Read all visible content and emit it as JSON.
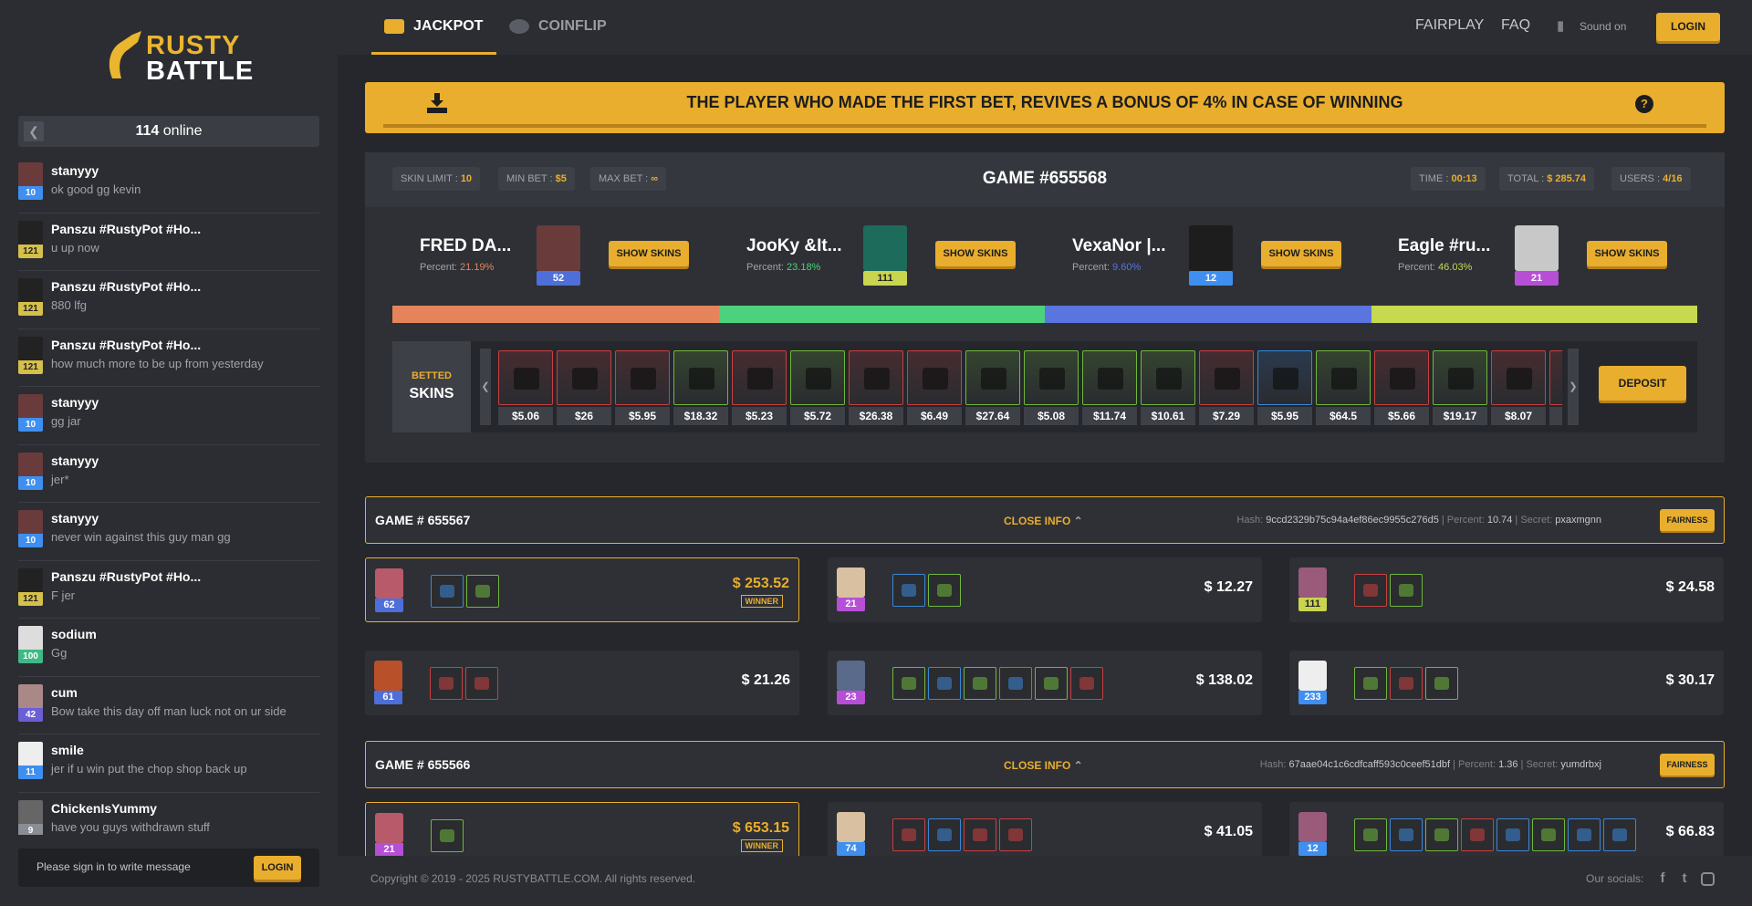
{
  "brand": {
    "line1": "RUSTY",
    "line2": "BATTLE"
  },
  "online": {
    "count": "114",
    "label": " online"
  },
  "chat": [
    {
      "name": "stanyyy",
      "text": "ok good gg kevin",
      "level": "10",
      "lvcolor": "#3f8ff0"
    },
    {
      "name": "Panszu #RustyPot #Ho...",
      "text": "u up now",
      "level": "121",
      "lvcolor": "#d4c04a"
    },
    {
      "name": "Panszu #RustyPot #Ho...",
      "text": "880 lfg",
      "level": "121",
      "lvcolor": "#d4c04a"
    },
    {
      "name": "Panszu #RustyPot #Ho...",
      "text": "how much more to be up from yesterday",
      "level": "121",
      "lvcolor": "#d4c04a"
    },
    {
      "name": "stanyyy",
      "text": "gg jar",
      "level": "10",
      "lvcolor": "#3f8ff0"
    },
    {
      "name": "stanyyy",
      "text": "jer*",
      "level": "10",
      "lvcolor": "#3f8ff0"
    },
    {
      "name": "stanyyy",
      "text": "never win against this guy man gg",
      "level": "10",
      "lvcolor": "#3f8ff0"
    },
    {
      "name": "Panszu #RustyPot #Ho...",
      "text": "F jer",
      "level": "121",
      "lvcolor": "#d4c04a"
    },
    {
      "name": "sodium",
      "text": "Gg",
      "level": "100",
      "lvcolor": "#3fb985"
    },
    {
      "name": "cum",
      "text": "Bow take this day off man luck not on ur side",
      "level": "42",
      "lvcolor": "#6a5fd6"
    },
    {
      "name": "smile",
      "text": "jer if u win put the chop shop back up",
      "level": "11",
      "lvcolor": "#3f8ff0"
    },
    {
      "name": "ChickenIsYummy",
      "text": "have you guys withdrawn stuff",
      "level": "9",
      "lvcolor": "#8a8d95"
    }
  ],
  "chat_input": {
    "placeholder": "Please sign in to write message",
    "login": "LOGIN"
  },
  "nav": {
    "jackpot": "JACKPOT",
    "coinflip": "COINFLIP",
    "fairplay": "FAIRPLAY",
    "faq": "FAQ",
    "sound": "Sound on",
    "login": "LOGIN"
  },
  "banner": {
    "text": "THE PLAYER WHO MADE THE FIRST BET, REVIVES A BONUS OF 4% IN CASE OF WINNING",
    "help": "?"
  },
  "game": {
    "title": "GAME #655568",
    "skin_limit_label": "SKIN LIMIT : ",
    "skin_limit": "10",
    "min_bet_label": "MIN BET : ",
    "min_bet": "$5",
    "max_bet_label": "MAX BET : ",
    "max_bet": "∞",
    "time_label": "TIME : ",
    "time": "00:13",
    "total_label": "TOTAL : ",
    "total": "$ 285.74",
    "users_label": "USERS : ",
    "users": "4/16",
    "show_skins": "SHOW SKINS",
    "percent_label": "Percent: ",
    "players": [
      {
        "name": "FRED DA...",
        "percent": "21.19%",
        "color": "#e5845a",
        "level": "52",
        "lvcolor": "#4e6fd9"
      },
      {
        "name": "JooKy &It...",
        "percent": "23.18%",
        "color": "#4cd27c",
        "level": "111",
        "lvcolor": "#c9d54e"
      },
      {
        "name": "VexaNor |...",
        "percent": "9.60%",
        "color": "#5a74e0",
        "level": "12",
        "lvcolor": "#3f8ff0"
      },
      {
        "name": "Eagle #ru...",
        "percent": "46.03%",
        "color": "#c6d94f",
        "level": "21",
        "lvcolor": "#b64fd6"
      }
    ],
    "betted_a": "BETTED",
    "betted_b": "SKINS",
    "deposit": "DEPOSIT",
    "skins": [
      {
        "price": "$5.06",
        "c": "#c84040"
      },
      {
        "price": "$26",
        "c": "#c84040"
      },
      {
        "price": "$5.95",
        "c": "#c84040"
      },
      {
        "price": "$18.32",
        "c": "#6fb83a"
      },
      {
        "price": "$5.23",
        "c": "#c84040"
      },
      {
        "price": "$5.72",
        "c": "#6fb83a"
      },
      {
        "price": "$26.38",
        "c": "#c84040"
      },
      {
        "price": "$6.49",
        "c": "#c84040"
      },
      {
        "price": "$27.64",
        "c": "#6fb83a"
      },
      {
        "price": "$5.08",
        "c": "#6fb83a"
      },
      {
        "price": "$11.74",
        "c": "#6fb83a"
      },
      {
        "price": "$10.61",
        "c": "#6fb83a"
      },
      {
        "price": "$7.29",
        "c": "#c84040"
      },
      {
        "price": "$5.95",
        "c": "#3b86d8"
      },
      {
        "price": "$64.5",
        "c": "#6fb83a"
      },
      {
        "price": "$5.66",
        "c": "#c84040"
      },
      {
        "price": "$19.17",
        "c": "#6fb83a"
      },
      {
        "price": "$8.07",
        "c": "#c84040"
      },
      {
        "price": "$",
        "c": "#c84040"
      }
    ]
  },
  "history": [
    {
      "title": "GAME # 655567",
      "close": "CLOSE INFO",
      "hash_label": "Hash: ",
      "hash": "9ccd2329b75c94a4ef86ec9955c276d5",
      "percent_label": " | Percent: ",
      "percent": "10.74",
      "secret_label": " | Secret: ",
      "secret": "pxaxmgnn",
      "fairness": "FAIRNESS",
      "cards": [
        {
          "amount": "$ 253.52",
          "winner": "WINNER",
          "level": "62",
          "lvcolor": "#4e6fd9",
          "items": [
            "#3b86d8",
            "#6fb83a"
          ]
        },
        {
          "amount": "$ 12.27",
          "winner": "",
          "level": "21",
          "lvcolor": "#b64fd6",
          "items": [
            "#3b86d8",
            "#6fb83a"
          ]
        },
        {
          "amount": "$ 24.58",
          "winner": "",
          "level": "111",
          "lvcolor": "#c9d54e",
          "items": [
            "#c84040",
            "#6fb83a"
          ]
        },
        {
          "amount": "$ 21.26",
          "winner": "",
          "level": "61",
          "lvcolor": "#4e6fd9",
          "items": [
            "#c84040",
            "#c84040"
          ]
        },
        {
          "amount": "$ 138.02",
          "winner": "",
          "level": "23",
          "lvcolor": "#b64fd6",
          "items": [
            "#6fb83a",
            "#3b86d8",
            "#6fb83a",
            "#3b86d8",
            "#6fb83a",
            "#c84040"
          ]
        },
        {
          "amount": "$ 30.17",
          "winner": "",
          "level": "233",
          "lvcolor": "#3f8ff0",
          "items": [
            "#6fb83a",
            "#c84040",
            "#6fb83a"
          ]
        }
      ]
    },
    {
      "title": "GAME # 655566",
      "close": "CLOSE INFO",
      "hash_label": "Hash: ",
      "hash": "67aae04c1c6cdfcaff593c0ceef51dbf",
      "percent_label": " | Percent: ",
      "percent": "1.36",
      "secret_label": " | Secret: ",
      "secret": "yumdrbxj",
      "fairness": "FAIRNESS",
      "cards": [
        {
          "amount": "$ 653.15",
          "winner": "WINNER",
          "level": "21",
          "lvcolor": "#b64fd6",
          "items": [
            "#6fb83a"
          ]
        },
        {
          "amount": "$ 41.05",
          "winner": "",
          "level": "74",
          "lvcolor": "#3f8ff0",
          "items": [
            "#c84040",
            "#3b86d8",
            "#c84040",
            "#c84040"
          ]
        },
        {
          "amount": "$ 66.83",
          "winner": "",
          "level": "12",
          "lvcolor": "#3f8ff0",
          "items": [
            "#6fb83a",
            "#3b86d8",
            "#6fb83a",
            "#c84040",
            "#3b86d8",
            "#6fb83a",
            "#3b86d8",
            "#3b86d8"
          ]
        }
      ]
    }
  ],
  "footer": {
    "copyright": "Copyright © 2019 - 2025 RUSTYBATTLE.COM. All rights reserved.",
    "socials": "Our socials:"
  }
}
